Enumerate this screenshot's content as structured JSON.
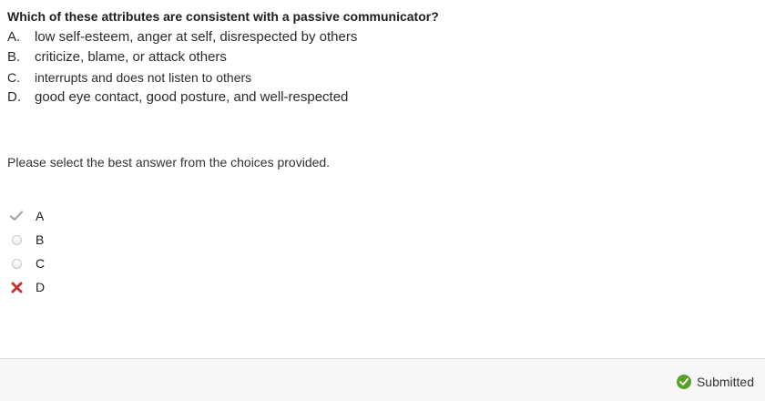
{
  "question": {
    "text": "Which of these attributes are consistent with a passive communicator?"
  },
  "choices": [
    {
      "letter": "A.",
      "text": "low self-esteem, anger at self, disrespected by others"
    },
    {
      "letter": "B.",
      "text": "criticize, blame, or attack others"
    },
    {
      "letter": "C.",
      "text": "interrupts and does not listen to others"
    },
    {
      "letter": "D.",
      "text": "good eye contact, good posture, and well-respected"
    }
  ],
  "instruction": "Please select the best answer from the choices provided.",
  "answer_options": [
    {
      "label": "A",
      "state": "correct",
      "icon": "checkmark-icon"
    },
    {
      "label": "B",
      "state": "unselected",
      "icon": "radio-icon"
    },
    {
      "label": "C",
      "state": "unselected",
      "icon": "radio-icon"
    },
    {
      "label": "D",
      "state": "incorrect",
      "icon": "x-icon"
    }
  ],
  "footer": {
    "status": "Submitted",
    "status_icon": "check-circle-icon"
  },
  "colors": {
    "correct_check": "#a8a8a8",
    "incorrect_x": "#c9312b",
    "submitted_green": "#5aa02c"
  }
}
